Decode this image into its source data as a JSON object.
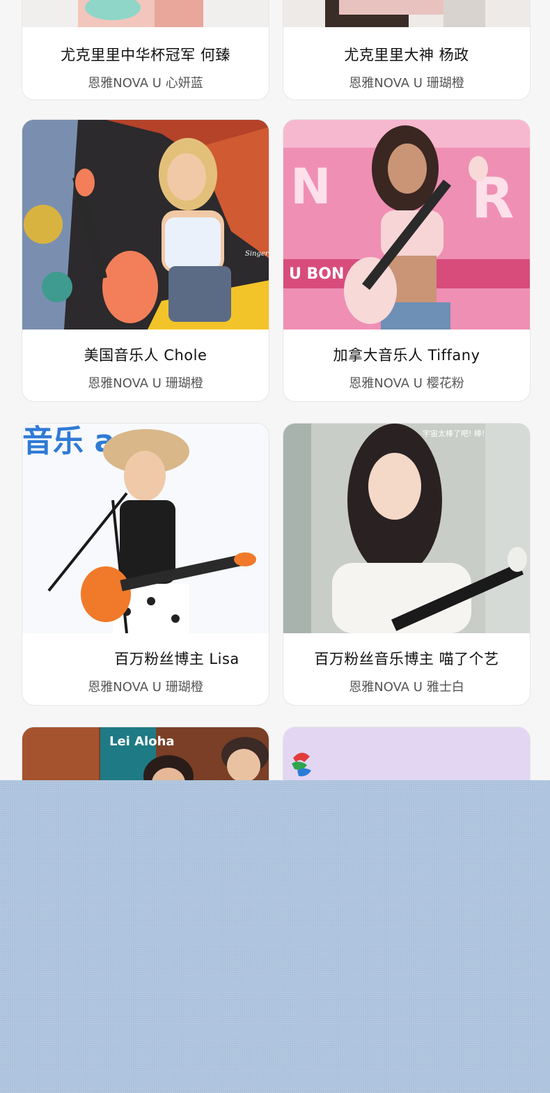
{
  "cards": [
    {
      "name": "尤克里里中华杯冠军 何臻",
      "model": "恩雅NOVA U 心妍蓝",
      "photo_color": "#8fd6c8"
    },
    {
      "name": "尤克里里大神 杨政",
      "model": "恩雅NOVA U 珊瑚橙",
      "photo_color": "#e9c9c2"
    },
    {
      "name": "美国音乐人 Chole",
      "model": "恩雅NOVA U 珊瑚橙",
      "photo_color": "#f08a5d",
      "photo_caption": "Singer Chloe"
    },
    {
      "name": "加拿大音乐人 Tiffany",
      "model": "恩雅NOVA U 樱花粉",
      "photo_color": "#ef8fb4",
      "photo_caption": "U BON   IS 1985! •"
    },
    {
      "name": "百万粉丝博主 Lisa",
      "model": "恩雅NOVA U 珊瑚橙",
      "photo_color": "#f07a2a",
      "photo_caption": "音乐 arty"
    },
    {
      "name": "百万粉丝音乐博主 喵了个艺",
      "model": "恩雅NOVA U 雅士白",
      "photo_color": "#c8cdc8",
      "photo_caption": "宇宙太棒了吧!  棒!"
    },
    {
      "photo_color": "#b85a2e",
      "photo_caption": "Lei Aloha"
    },
    {
      "photo_color": "#e2d6f2"
    }
  ],
  "overlay": {
    "color": "#adc3dd"
  }
}
